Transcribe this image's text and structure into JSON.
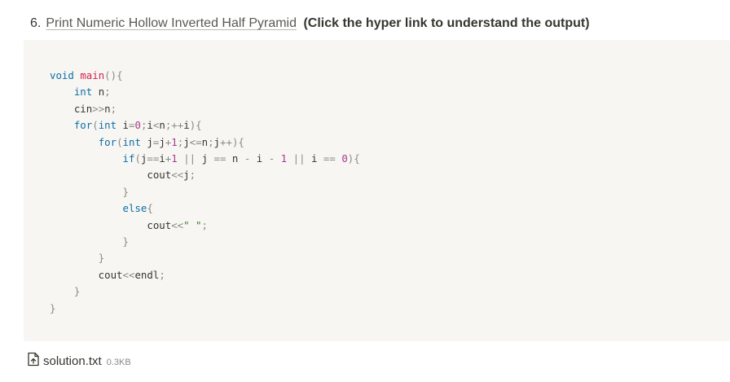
{
  "heading": {
    "number": "6.",
    "link_text": "Print Numeric Hollow Inverted Half Pyramid",
    "note": "(Click the hyper link to understand the output)"
  },
  "code": {
    "language": "cpp",
    "lines": [
      "void main(){",
      "    int n;",
      "    cin>>n;",
      "    for(int i=0;i<n;++i){",
      "        for(int j=j+1;j<=n;j++){",
      "            if(j==i+1 || j == n - i - 1 || i == 0){",
      "                cout<<j;",
      "            }",
      "            else{",
      "                cout<<\" \";",
      "            }",
      "        }",
      "        cout<<endl;",
      "    }",
      "}"
    ]
  },
  "attachment": {
    "icon": "file-upload-icon",
    "filename": "solution.txt",
    "size": "0.3KB"
  }
}
